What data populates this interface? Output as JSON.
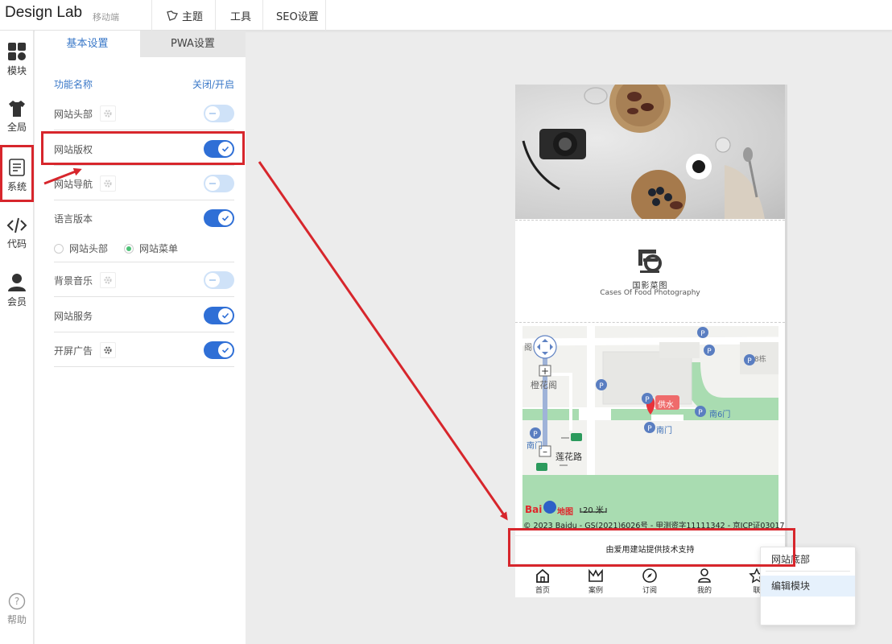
{
  "topbar": {
    "brand": "Design Lab",
    "mobile": "移动端",
    "theme": "主题",
    "tools": "工具",
    "seo": "SEO设置"
  },
  "iconbar": {
    "modules": "模块",
    "global": "全局",
    "system": "系统",
    "code": "代码",
    "member": "会员",
    "help": "帮助"
  },
  "panel": {
    "tabs": [
      "基本设置",
      "PWA设置"
    ],
    "header_name": "功能名称",
    "header_toggle": "关闭/开启",
    "rows": [
      {
        "label": "网站头部",
        "on": false
      },
      {
        "label": "网站版权",
        "on": true
      },
      {
        "label": "网站导航",
        "on": false
      },
      {
        "label": "语言版本",
        "on": true
      },
      {
        "label": "背景音乐",
        "on": false
      },
      {
        "label": "网站服务",
        "on": true
      },
      {
        "label": "开屏广告",
        "on": true
      }
    ],
    "language_options": [
      "网站头部",
      "网站菜单"
    ],
    "language_selected": "网站菜单"
  },
  "preview": {
    "logo_cn": "国影菜图",
    "logo_en": "Cases Of Food Photography",
    "map_labels": {
      "gate_south": "南门",
      "gate_south_left": "南门",
      "gate_south6": "南6门",
      "building8": "8栋",
      "cheng_hua_ge": "橙花阁",
      "supply": "供水",
      "road": "莲花路",
      "partial": "阁",
      "scale": "20 米",
      "baidu": "Bai",
      "baidu2": "地图"
    },
    "map_copyright": "© 2023 Baidu - GS(2021)6026号 - 甲测资字11111342 - 京ICP证03017",
    "footer_text": "由爱用建站提供技术支持",
    "nav": [
      "首页",
      "案例",
      "订阅",
      "我的",
      "联"
    ]
  },
  "context_menu": {
    "items": [
      "网站底部",
      "编辑模块"
    ]
  },
  "colors": {
    "accent": "#3a78c8",
    "toggle_on": "#2f6fd6",
    "toggle_off": "#cfe2f8",
    "annotation_red": "#d7262c",
    "radio_green": "#4cc176"
  }
}
